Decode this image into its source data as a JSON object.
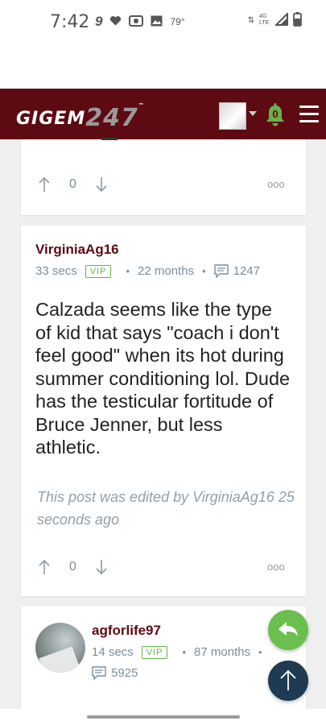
{
  "status_bar": {
    "time": "7:42",
    "temp": "79°",
    "network": "4G LTE",
    "icons": [
      "nine-app-icon",
      "heart-icon",
      "radio-icon",
      "image-icon",
      "data-arrows-icon",
      "signal-icon",
      "battery-icon"
    ]
  },
  "header": {
    "logo_text": "GIGEM",
    "logo_number": "247",
    "logo_tm": "™",
    "notification_count": "0",
    "colors": {
      "bar": "#5d0a12",
      "bell": "#6ab04c"
    }
  },
  "posts": [
    {
      "votes": "0",
      "more": "ooo"
    },
    {
      "username": "VirginiaAg16",
      "time": "33 secs",
      "badge": "VIP",
      "tenure": "22 months",
      "post_count": "1247",
      "body": "Calzada seems like the type of kid that says \"coach i don't feel good\" when its hot during summer conditioning lol. Dude has the testicular fortitude of Bruce Jenner, but less athletic.",
      "edited_note": "This post was edited by VirginiaAg16 25 seconds ago",
      "votes": "0",
      "more": "ooo"
    },
    {
      "username": "agforlife97",
      "time": "14 secs",
      "badge": "VIP",
      "tenure": "87 months",
      "post_count": "5925"
    }
  ],
  "colors": {
    "accent_green": "#6bbf4e",
    "scroll_top": "#1e3b52",
    "username": "#5d0a12"
  }
}
